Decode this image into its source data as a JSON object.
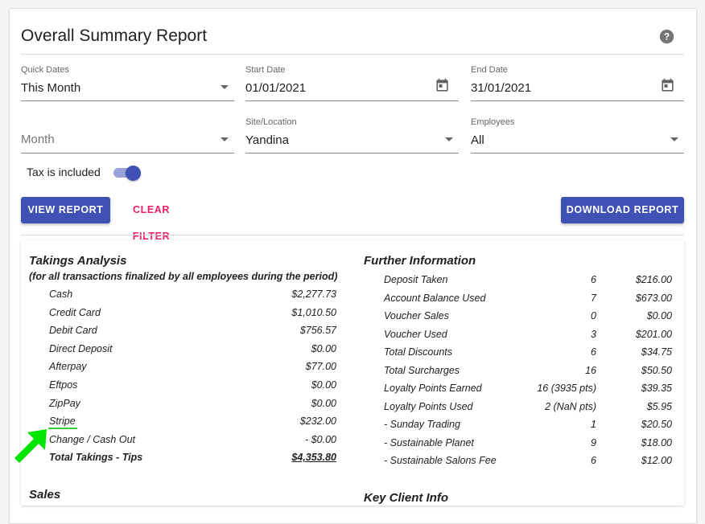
{
  "report": {
    "title": "Overall Summary Report",
    "help_icon": "help-circle-icon"
  },
  "filters": {
    "quick_dates": {
      "label": "Quick Dates",
      "value": "This Month"
    },
    "start_date": {
      "label": "Start Date",
      "value": "01/01/2021"
    },
    "end_date": {
      "label": "End Date",
      "value": "31/01/2021"
    },
    "month": {
      "placeholder": "Month"
    },
    "site": {
      "label": "Site/Location",
      "value": "Yandina"
    },
    "employees": {
      "label": "Employees",
      "value": "All"
    },
    "tax_toggle": {
      "label": "Tax is included",
      "on": true
    }
  },
  "buttons": {
    "view_report": "VIEW REPORT",
    "clear_filter": "CLEAR FILTER",
    "download_report": "DOWNLOAD REPORT"
  },
  "colors": {
    "primary": "#3f51b5",
    "accent": "#e91e63",
    "annotation": "#2ecc40",
    "arrow": "#00e600"
  },
  "takings": {
    "title": "Takings Analysis",
    "subtitle": "(for all transactions finalized by all employees during the period)",
    "rows": [
      {
        "label": "Cash",
        "value": "$2,277.73"
      },
      {
        "label": "Credit Card",
        "value": "$1,010.50"
      },
      {
        "label": "Debit Card",
        "value": "$756.57"
      },
      {
        "label": "Direct Deposit",
        "value": "$0.00"
      },
      {
        "label": "Afterpay",
        "value": "$77.00"
      },
      {
        "label": "Eftpos",
        "value": "$0.00"
      },
      {
        "label": "ZipPay",
        "value": "$0.00"
      },
      {
        "label": "Stripe",
        "value": "$232.00"
      },
      {
        "label": "Change / Cash Out",
        "value": "- $0.00"
      }
    ],
    "total": {
      "label": "Total Takings - Tips",
      "value": "$4,353.80"
    }
  },
  "further": {
    "title": "Further Information",
    "rows": [
      {
        "label": "Deposit Taken",
        "count": "6",
        "value": "$216.00"
      },
      {
        "label": "Account Balance Used",
        "count": "7",
        "value": "$673.00"
      },
      {
        "label": "Voucher Sales",
        "count": "0",
        "value": "$0.00"
      },
      {
        "label": "Voucher Used",
        "count": "3",
        "value": "$201.00"
      },
      {
        "label": "Total Discounts",
        "count": "6",
        "value": "$34.75"
      },
      {
        "label": "Total Surcharges",
        "count": "16",
        "value": "$50.50"
      },
      {
        "label": "Loyalty Points Earned",
        "count": "16 (3935 pts)",
        "value": "$39.35"
      },
      {
        "label": "Loyalty Points Used",
        "count": "2 (NaN pts)",
        "value": "$5.95"
      },
      {
        "label": "- Sunday Trading",
        "count": "1",
        "value": "$20.50"
      },
      {
        "label": "- Sustainable Planet",
        "count": "9",
        "value": "$18.00"
      },
      {
        "label": "- Sustainable Salons Fee",
        "count": "6",
        "value": "$12.00"
      }
    ]
  },
  "sales": {
    "title": "Sales"
  },
  "key_client": {
    "title": "Key Client Info"
  }
}
